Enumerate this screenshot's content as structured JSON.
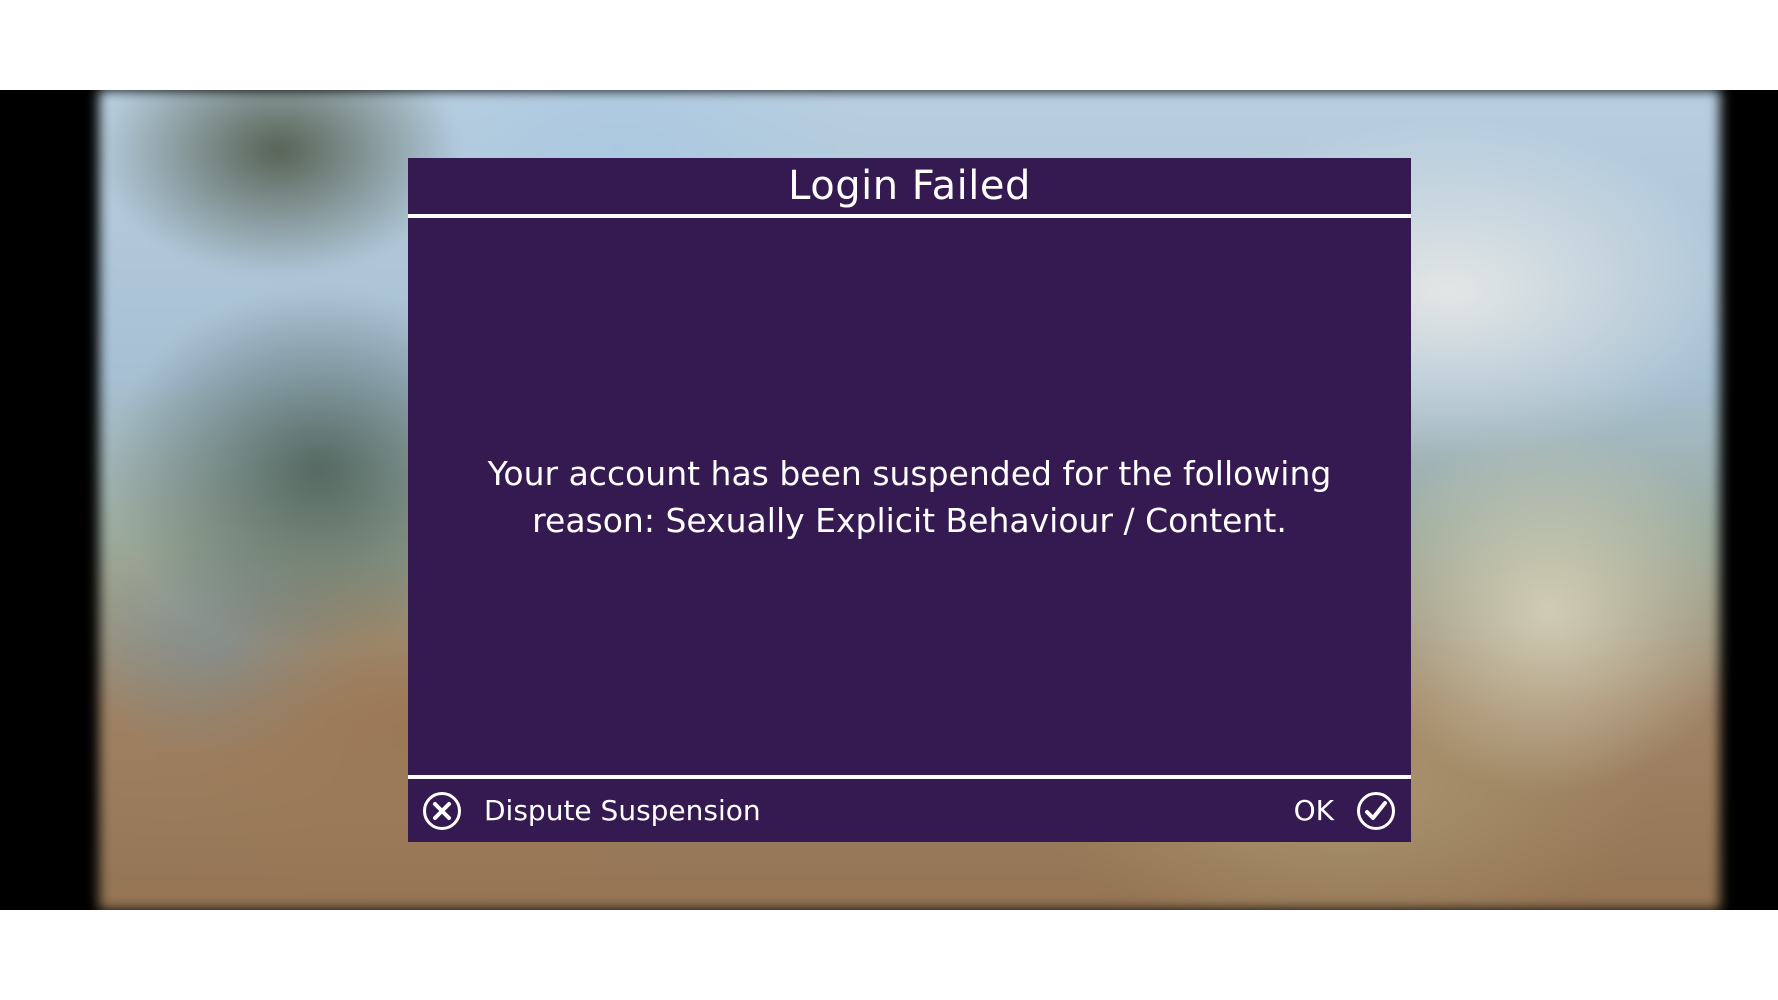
{
  "dialog": {
    "title": "Login Failed",
    "message": "Your account has been suspended for the following reason: Sexually Explicit Behaviour / Content.",
    "dispute_button": {
      "label": "Dispute Suspension",
      "icon": "close-circle-icon"
    },
    "ok_button": {
      "label": "OK",
      "icon": "checkmark-circle-icon"
    }
  },
  "colors": {
    "dialog_background": "#351a52",
    "dialog_text": "#ffffff",
    "divider": "#ffffff",
    "letterbox": "#000000"
  }
}
